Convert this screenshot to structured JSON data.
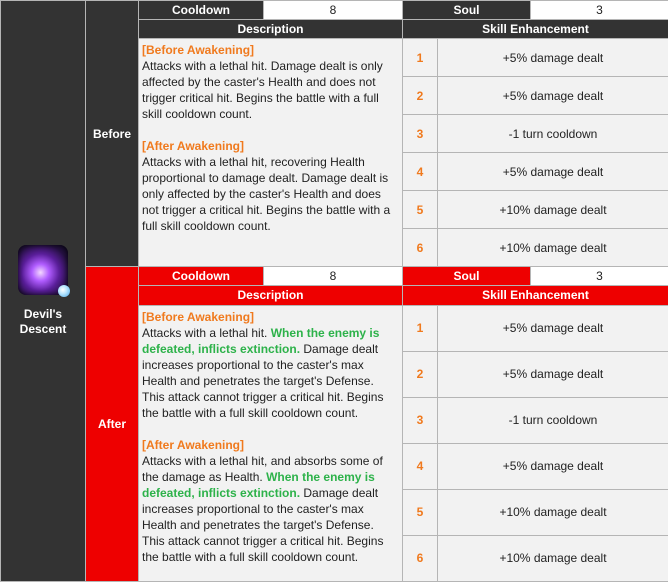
{
  "skill": {
    "name": "Devil's Descent"
  },
  "labels": {
    "cooldown": "Cooldown",
    "soul": "Soul",
    "description": "Description",
    "enhancement": "Skill Enhancement"
  },
  "before": {
    "label": "Before",
    "cooldown": "8",
    "soul": "3",
    "before_awakening_heading": "[Before Awakening]",
    "before_awakening_text": "Attacks with a lethal hit. Damage dealt is only affected by the caster's Health and does not trigger critical hit. Begins the battle with a full skill cooldown count.",
    "after_awakening_heading": "[After Awakening]",
    "after_awakening_text": "Attacks with a lethal hit, recovering Health proportional to damage dealt. Damage dealt is only affected by the caster's Health and does not trigger a critical hit. Begins the battle with a full skill cooldown count.",
    "enhancements": [
      {
        "level": "1",
        "effect": "+5% damage dealt"
      },
      {
        "level": "2",
        "effect": "+5% damage dealt"
      },
      {
        "level": "3",
        "effect": "-1 turn cooldown"
      },
      {
        "level": "4",
        "effect": "+5% damage dealt"
      },
      {
        "level": "5",
        "effect": "+10% damage dealt"
      },
      {
        "level": "6",
        "effect": "+10% damage dealt"
      }
    ]
  },
  "after": {
    "label": "After",
    "cooldown": "8",
    "soul": "3",
    "before_awakening_heading": "[Before Awakening]",
    "before_awakening_pre": "Attacks with a lethal hit. ",
    "before_awakening_highlight": "When the enemy is defeated, inflicts extinction.",
    "before_awakening_post": " Damage dealt increases proportional to the caster's max Health and penetrates the target's Defense. This attack cannot trigger a critical hit. Begins the battle with a full skill cooldown count.",
    "after_awakening_heading": "[After Awakening]",
    "after_awakening_pre": "Attacks with a lethal hit, and absorbs some of the damage as Health. ",
    "after_awakening_highlight": "When the enemy is defeated, inflicts extinction.",
    "after_awakening_post": " Damage dealt increases proportional to the caster's max Health and penetrates the target's Defense. This attack cannot trigger a critical hit. Begins the battle with a full skill cooldown count.",
    "enhancements": [
      {
        "level": "1",
        "effect": "+5% damage dealt"
      },
      {
        "level": "2",
        "effect": "+5% damage dealt"
      },
      {
        "level": "3",
        "effect": "-1 turn cooldown"
      },
      {
        "level": "4",
        "effect": "+5% damage dealt"
      },
      {
        "level": "5",
        "effect": "+10% damage dealt"
      },
      {
        "level": "6",
        "effect": "+10% damage dealt"
      }
    ]
  }
}
